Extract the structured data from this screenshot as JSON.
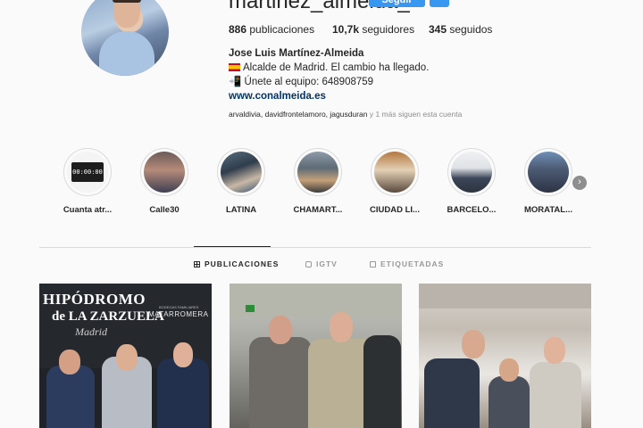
{
  "profile": {
    "username": "martinez_almeida_",
    "follow_label": "Seguir",
    "more_label": "•••",
    "stats": {
      "posts_count": "886",
      "posts_label": "publicaciones",
      "followers_count": "10,7k",
      "followers_label": "seguidores",
      "following_count": "345",
      "following_label": "seguidos"
    },
    "bio": {
      "name": "Jose Luis Martínez-Almeida",
      "line1": "Alcalde de Madrid. El cambio ha llegado.",
      "line2_emoji": "📲",
      "line2": "Únete al equipo: 648908759",
      "link": "www.conalmeida.es"
    },
    "followed_by": {
      "names": "arvaldivia, davidfrontelamoro, jagusduran",
      "suffix": "y 1 más siguen esta cuenta"
    }
  },
  "highlights": [
    {
      "label": "Cuanta atr..."
    },
    {
      "label": "Calle30"
    },
    {
      "label": "LATINA"
    },
    {
      "label": "CHAMART..."
    },
    {
      "label": "CIUDAD LI..."
    },
    {
      "label": "BARCELO..."
    },
    {
      "label": "MORATAL..."
    }
  ],
  "highlight_clock_text": "00:00:00",
  "next_arrow": "›",
  "tabs": {
    "posts": "PUBLICACIONES",
    "igtv": "IGTV",
    "tagged": "ETIQUETADAS"
  },
  "posts": {
    "post1": {
      "title_line1": "HIPÓDROMO",
      "title_line2": "de LA ZARZUELA",
      "title_line3": "Madrid",
      "sponsor_top": "BODEGAS FAMILIARES",
      "sponsor": "MATARROMERA"
    }
  },
  "colors": {
    "accent": "#3897f0",
    "background": "#fafafa",
    "text": "#262626",
    "muted": "#8e8e8e",
    "link": "#003569"
  }
}
